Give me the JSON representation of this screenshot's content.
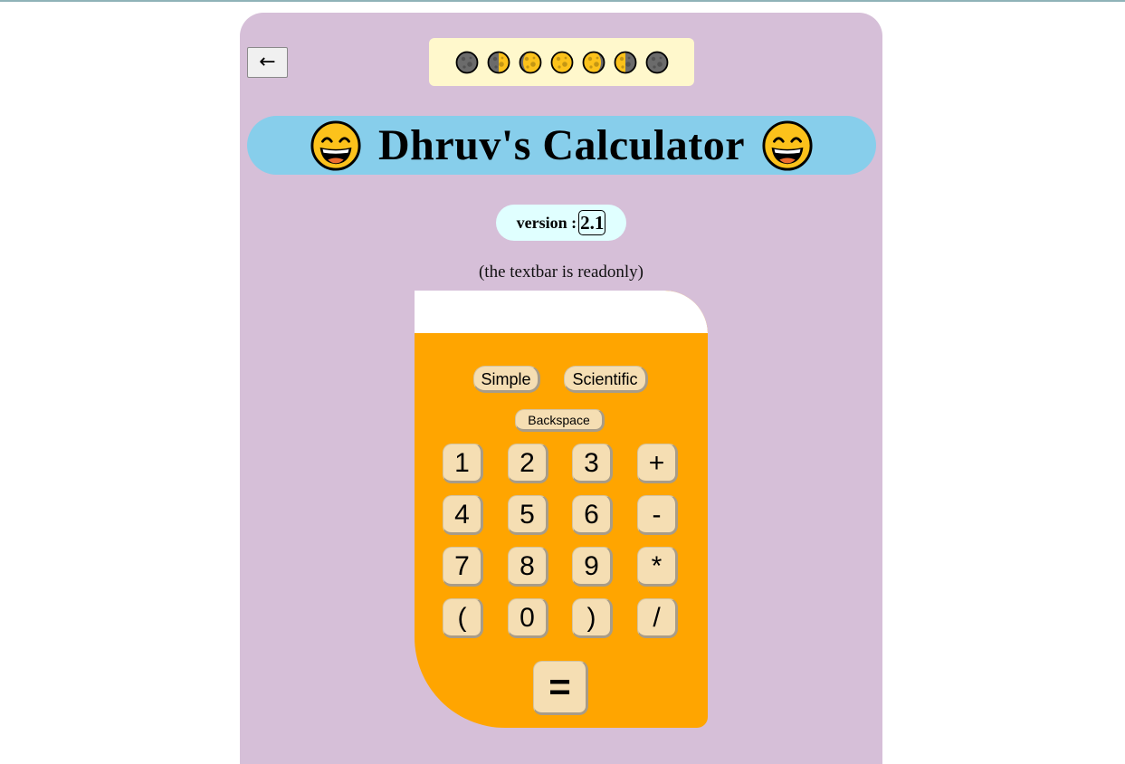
{
  "nav": {
    "back_label": "←"
  },
  "moon_phases": [
    {
      "icon": "new-moon-icon",
      "lit": 0.0
    },
    {
      "icon": "first-quarter-moon-icon",
      "lit": 0.5
    },
    {
      "icon": "waxing-gibbous-moon-icon",
      "lit": 0.85
    },
    {
      "icon": "full-moon-icon",
      "lit": 1.0
    },
    {
      "icon": "waning-gibbous-moon-icon",
      "lit": 0.85
    },
    {
      "icon": "last-quarter-moon-icon",
      "lit": 0.5
    },
    {
      "icon": "new-moon-icon",
      "lit": 0.0
    }
  ],
  "header": {
    "title": "Dhruv's Calculator",
    "emoji_icon": "grinning-face-icon"
  },
  "version": {
    "label": "version :",
    "number": "2.1"
  },
  "note": "(the textbar is readonly)",
  "calculator": {
    "display_value": "",
    "modes": [
      "Simple",
      "Scientific"
    ],
    "backspace_label": "Backspace",
    "keys": [
      [
        "1",
        "2",
        "3",
        "+"
      ],
      [
        "4",
        "5",
        "6",
        "-"
      ],
      [
        "7",
        "8",
        "9",
        "*"
      ],
      [
        "(",
        "0",
        ")",
        "/"
      ]
    ],
    "equals_label": "="
  },
  "colors": {
    "card": "#d6bfd8",
    "title_bar": "#87ceeb",
    "moon_box": "#fff8cc",
    "version_pill": "#e0ffff",
    "calculator_body": "#ffa500",
    "key": "#f5deb3"
  }
}
